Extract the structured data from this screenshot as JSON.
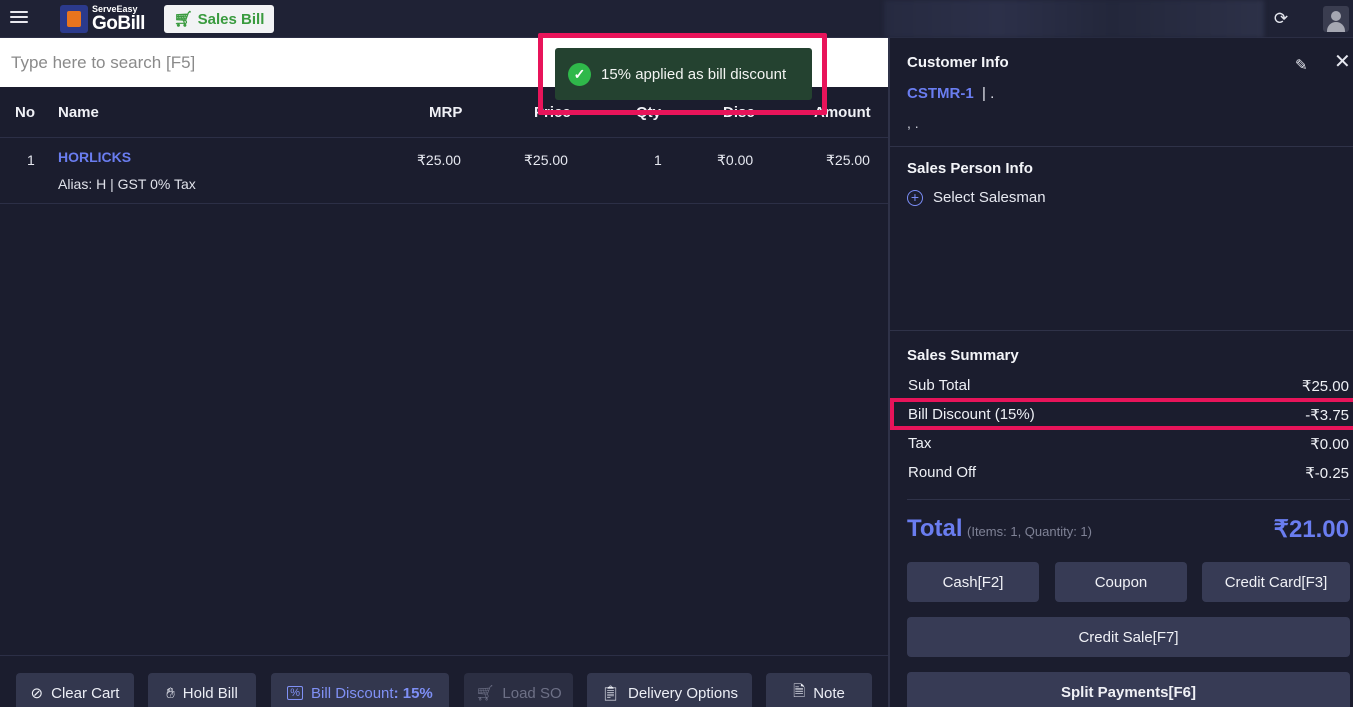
{
  "topbar": {
    "brand_small": "ServeEasy",
    "brand_big": "GoBill",
    "sales_bill_label": "Sales Bill"
  },
  "search": {
    "placeholder": "Type here to search [F5]"
  },
  "table": {
    "headers": {
      "no": "No",
      "name": "Name",
      "mrp": "MRP",
      "price": "Price",
      "qty": "Qty",
      "disc": "Disc",
      "amount": "Amount"
    },
    "rows": [
      {
        "no": "1",
        "name": "HORLICKS",
        "alias": "Alias: H | GST 0% Tax",
        "mrp": "₹25.00",
        "price": "₹25.00",
        "qty": "1",
        "disc": "₹0.00",
        "amount": "₹25.00"
      }
    ]
  },
  "toast": {
    "message": "15% applied as bill discount"
  },
  "bottom_bar": {
    "clear_cart": "Clear Cart",
    "hold_bill": "Hold Bill",
    "bill_discount": "Bill Discount",
    "bill_discount_value": ": 15%",
    "load_so": "Load SO",
    "delivery_options": "Delivery Options",
    "note": "Note"
  },
  "customer": {
    "title": "Customer Info",
    "id": "CSTMR-1",
    "name_suffix": "| .",
    "line2": ", ."
  },
  "sales_person": {
    "title": "Sales Person Info",
    "select_label": "Select Salesman"
  },
  "summary": {
    "title": "Sales Summary",
    "sub_total_label": "Sub Total",
    "sub_total": "₹25.00",
    "bill_discount_label": "Bill Discount (15%)",
    "bill_discount": "-₹3.75",
    "tax_label": "Tax",
    "tax": "₹0.00",
    "round_off_label": "Round Off",
    "round_off": "₹-0.25",
    "total_label": "Total",
    "total_meta": "(Items: 1, Quantity: 1)",
    "total_value": "₹21.00"
  },
  "payments": {
    "cash": "Cash[F2]",
    "coupon": "Coupon",
    "credit_card": "Credit Card[F3]",
    "credit_sale": "Credit Sale[F7]",
    "split": "Split Payments[F6]"
  },
  "colors": {
    "accent": "#6a7df0",
    "highlight": "#e8145a",
    "success": "#2fb84a",
    "brand_green": "#3a9b3f"
  }
}
